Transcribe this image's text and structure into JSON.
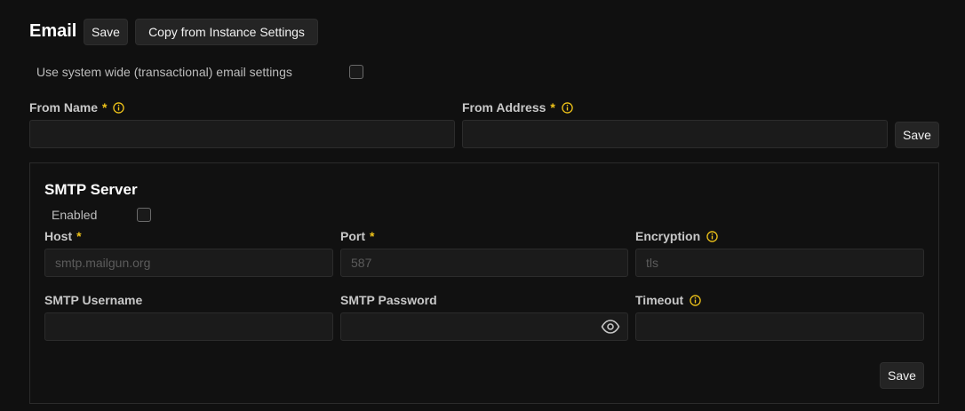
{
  "header": {
    "title": "Email",
    "save_label": "Save",
    "copy_label": "Copy from Instance Settings"
  },
  "system_wide": {
    "label": "Use system wide (transactional) email settings",
    "checked": false
  },
  "from": {
    "name_label": "From Name",
    "address_label": "From Address",
    "required_mark": "*",
    "name_value": "",
    "address_value": "",
    "save_label": "Save"
  },
  "smtp": {
    "title": "SMTP Server",
    "enabled_label": "Enabled",
    "enabled": false,
    "required_mark": "*",
    "host_label": "Host",
    "host_placeholder": "smtp.mailgun.org",
    "port_label": "Port",
    "port_placeholder": "587",
    "encryption_label": "Encryption",
    "encryption_placeholder": "tls",
    "username_label": "SMTP Username",
    "password_label": "SMTP Password",
    "timeout_label": "Timeout",
    "save_label": "Save"
  },
  "icons": {
    "info": "info-circle-icon",
    "eye": "eye-icon"
  },
  "colors": {
    "background": "#101010",
    "required_accent": "#f0c419",
    "info_accent": "#f0c419"
  }
}
